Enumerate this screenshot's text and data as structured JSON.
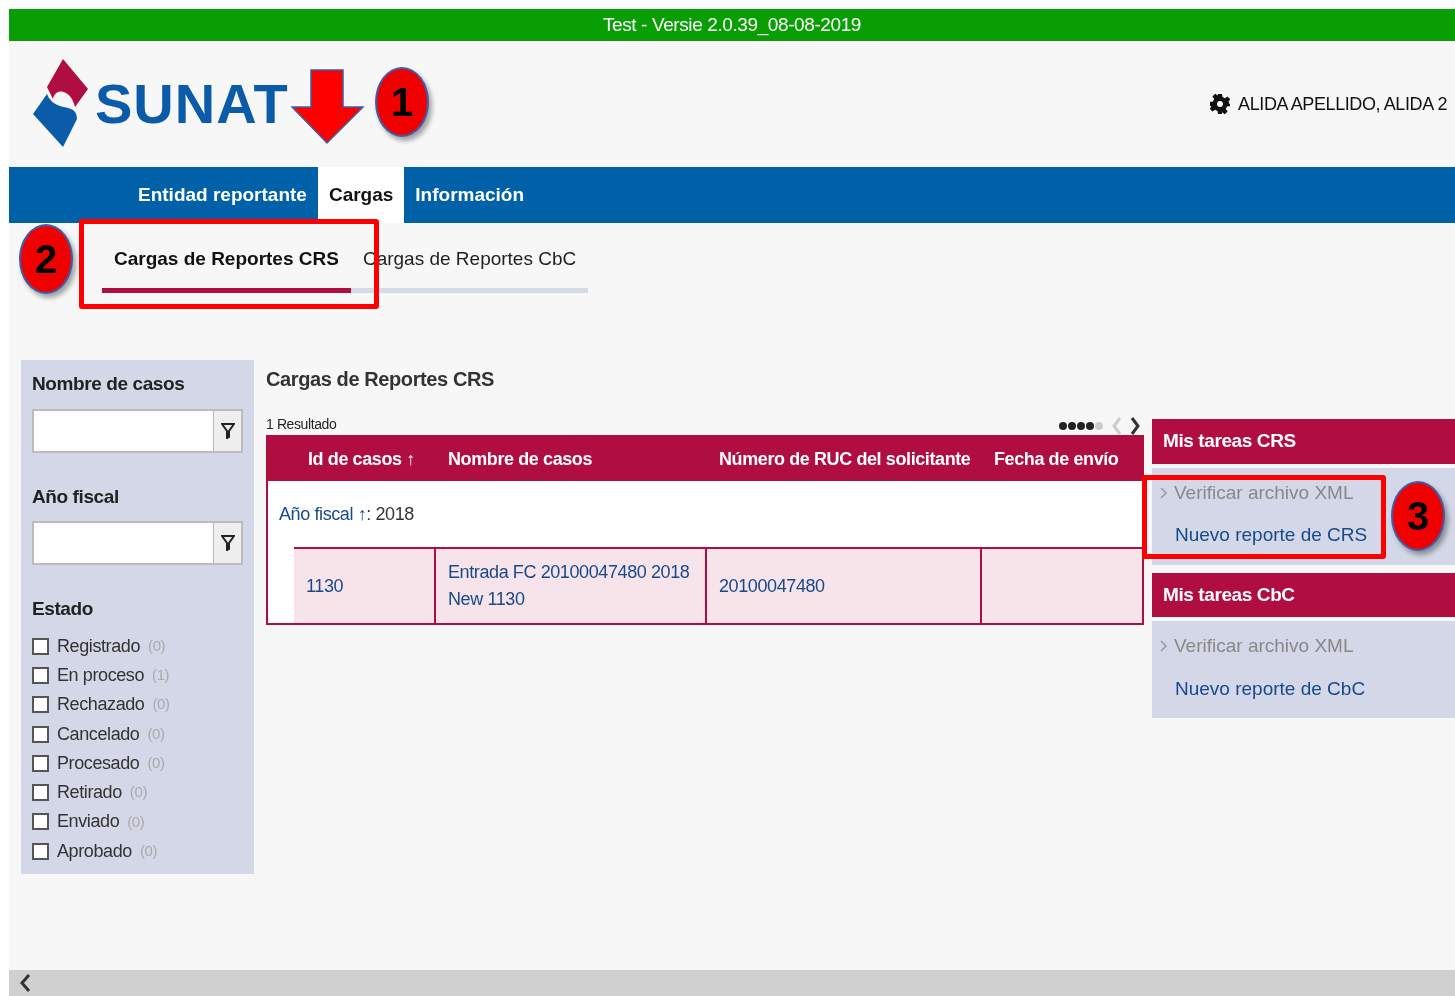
{
  "banner": {
    "text": "Test - Versie 2.0.39_08-08-2019"
  },
  "logo": {
    "text": "SUNAT"
  },
  "user": {
    "name": "ALIDA APELLIDO, ALIDA 2"
  },
  "nav": [
    {
      "label": "Entidad reportante",
      "selected": false
    },
    {
      "label": "Cargas",
      "selected": true
    },
    {
      "label": "Información",
      "selected": false
    }
  ],
  "subtabs": [
    {
      "label": "Cargas de Reportes CRS",
      "selected": true
    },
    {
      "label": "Cargas de Reportes CbC",
      "selected": false
    }
  ],
  "filters": {
    "fields": [
      {
        "label": "Nombre de casos"
      },
      {
        "label": "Año fiscal"
      }
    ],
    "status_label": "Estado",
    "statuses": [
      {
        "label": "Registrado",
        "count": "(0)",
        "checked": false
      },
      {
        "label": "En proceso",
        "count": "(1)",
        "checked": false
      },
      {
        "label": "Rechazado",
        "count": "(0)",
        "checked": false
      },
      {
        "label": "Cancelado",
        "count": "(0)",
        "checked": false
      },
      {
        "label": "Procesado",
        "count": "(0)",
        "checked": false
      },
      {
        "label": "Retirado",
        "count": "(0)",
        "checked": false
      },
      {
        "label": "Enviado",
        "count": "(0)",
        "checked": false
      },
      {
        "label": "Aprobado",
        "count": "(0)",
        "checked": false
      }
    ]
  },
  "results": {
    "title": "Cargas de Reportes CRS",
    "count": "1 Resultado",
    "pager": {
      "prev_disabled": true,
      "next_disabled": false
    },
    "columns": [
      "Id de casos ↑",
      "Nombre de casos",
      "Número de RUC del solicitante",
      "Fecha de envío"
    ],
    "group": {
      "label": "Año fiscal ↑",
      "value": ": 2018"
    },
    "rows": [
      {
        "cells": [
          "1130",
          "Entrada FC 20100047480 2018 New 1130",
          "20100047480"
        ]
      }
    ]
  },
  "tasks": [
    {
      "title": "Mis tareas CRS",
      "items": [
        {
          "label": "Verificar archivo XML",
          "disabled": true
        },
        {
          "label": "Nuevo reporte de CRS",
          "disabled": false
        }
      ]
    },
    {
      "title": "Mis tareas CbC",
      "items": [
        {
          "label": "Verificar archivo XML",
          "disabled": true
        },
        {
          "label": "Nuevo reporte de CbC",
          "disabled": false
        }
      ]
    }
  ],
  "callouts": [
    {
      "number": "1"
    },
    {
      "number": "2"
    },
    {
      "number": "3"
    }
  ]
}
